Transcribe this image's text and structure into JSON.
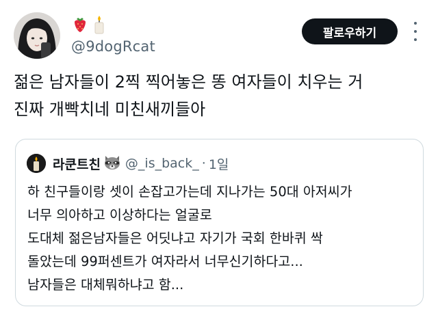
{
  "author": {
    "name_emojis": [
      "strawberry",
      "candle"
    ],
    "handle": "@9dogRcat"
  },
  "follow_button": {
    "label": "팔로우하기"
  },
  "more_button": {
    "icon": "more-vertical-icon"
  },
  "tweet": {
    "lines": [
      "젊은 남자들이 2찍 찍어놓은 똥 여자들이 치우는 거",
      "진짜 개빡치네 미친새끼들아"
    ]
  },
  "quoted_tweet": {
    "name": "라쿤트친",
    "name_emoji": "raccoon",
    "handle": "@_is_back_",
    "separator": "·",
    "time": "1일",
    "lines": [
      "하 친구들이랑 셋이 손잡고가는데 지나가는 50대 아저씨가",
      "너무 의아하고 이상하다는 얼굴로",
      "도대체 젊은남자들은 어딧냐고 자기가 국회 한바퀴 싹",
      "돌았는데 99퍼센트가 여자라서 너무신기하다고...",
      "남자들은 대체뭐하냐고 함..."
    ]
  },
  "colors": {
    "text": "#0f1419",
    "secondary": "#536471",
    "button_bg": "#0f1419",
    "border": "#cfd9de"
  }
}
